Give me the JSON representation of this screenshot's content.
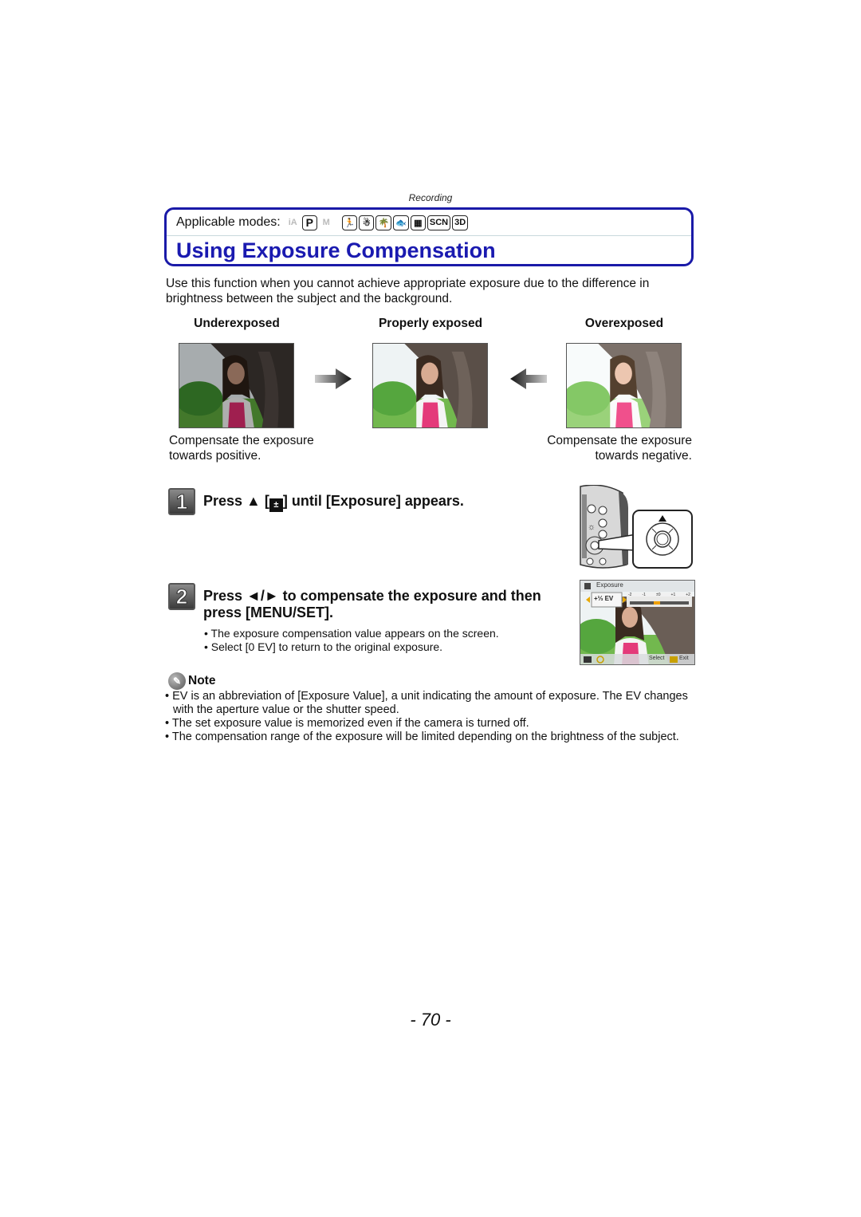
{
  "header": {
    "section": "Recording"
  },
  "title_box": {
    "modes_label": "Applicable modes:",
    "modes": [
      {
        "name": "intelligent-auto",
        "label": "iA",
        "enabled": false
      },
      {
        "name": "program",
        "label": "P",
        "enabled": true
      },
      {
        "name": "motion-picture",
        "label": "M",
        "enabled": false
      },
      {
        "name": "sports",
        "label": "🏃",
        "enabled": true
      },
      {
        "name": "snow",
        "label": "☃",
        "enabled": true
      },
      {
        "name": "beach-snorkeling",
        "label": "🌴",
        "enabled": true
      },
      {
        "name": "underwater",
        "label": "🐟",
        "enabled": true
      },
      {
        "name": "miniature",
        "label": "▦",
        "enabled": true
      },
      {
        "name": "scene",
        "label": "SCN",
        "enabled": true
      },
      {
        "name": "3d",
        "label": "3D",
        "enabled": true
      }
    ],
    "title": "Using Exposure Compensation"
  },
  "intro": "Use this function when you cannot achieve appropriate exposure due to the difference in brightness between the subject and the background.",
  "comparison": {
    "columns": [
      {
        "label": "Underexposed",
        "brightness": "dark"
      },
      {
        "label": "Properly exposed",
        "brightness": "normal"
      },
      {
        "label": "Overexposed",
        "brightness": "bright"
      }
    ],
    "caption_left": [
      "Compensate the exposure",
      "towards positive."
    ],
    "caption_right": [
      "Compensate the exposure",
      "towards negative."
    ]
  },
  "steps": [
    {
      "number": "1",
      "text_prefix": "Press ▲ [",
      "text_icon": "exposure-compensation-icon",
      "text_suffix": "] until [Exposure] appears."
    },
    {
      "number": "2",
      "line1": "Press ◄/► to compensate the exposure and then",
      "line2": "press [MENU/SET].",
      "bullets": [
        "• The exposure compensation value appears on the screen.",
        "• Select [0 EV] to return to the original exposure."
      ]
    }
  ],
  "lcd_screen": {
    "menu_title": "Exposure",
    "value": "+⅓ EV",
    "scale_labels": [
      "-2",
      "-1",
      "±0",
      "+1",
      "+2"
    ],
    "footer_select": "Select",
    "footer_exit": "Exit"
  },
  "note": {
    "heading": "Note",
    "items": [
      "• EV is an abbreviation of [Exposure Value], a unit indicating the amount of exposure. The EV changes with the aperture value or the shutter speed.",
      "• The set exposure value is memorized even if the camera is turned off.",
      "• The compensation range of the exposure will be limited depending on the brightness of the subject."
    ]
  },
  "footer": {
    "page_number": "- 70 -"
  }
}
